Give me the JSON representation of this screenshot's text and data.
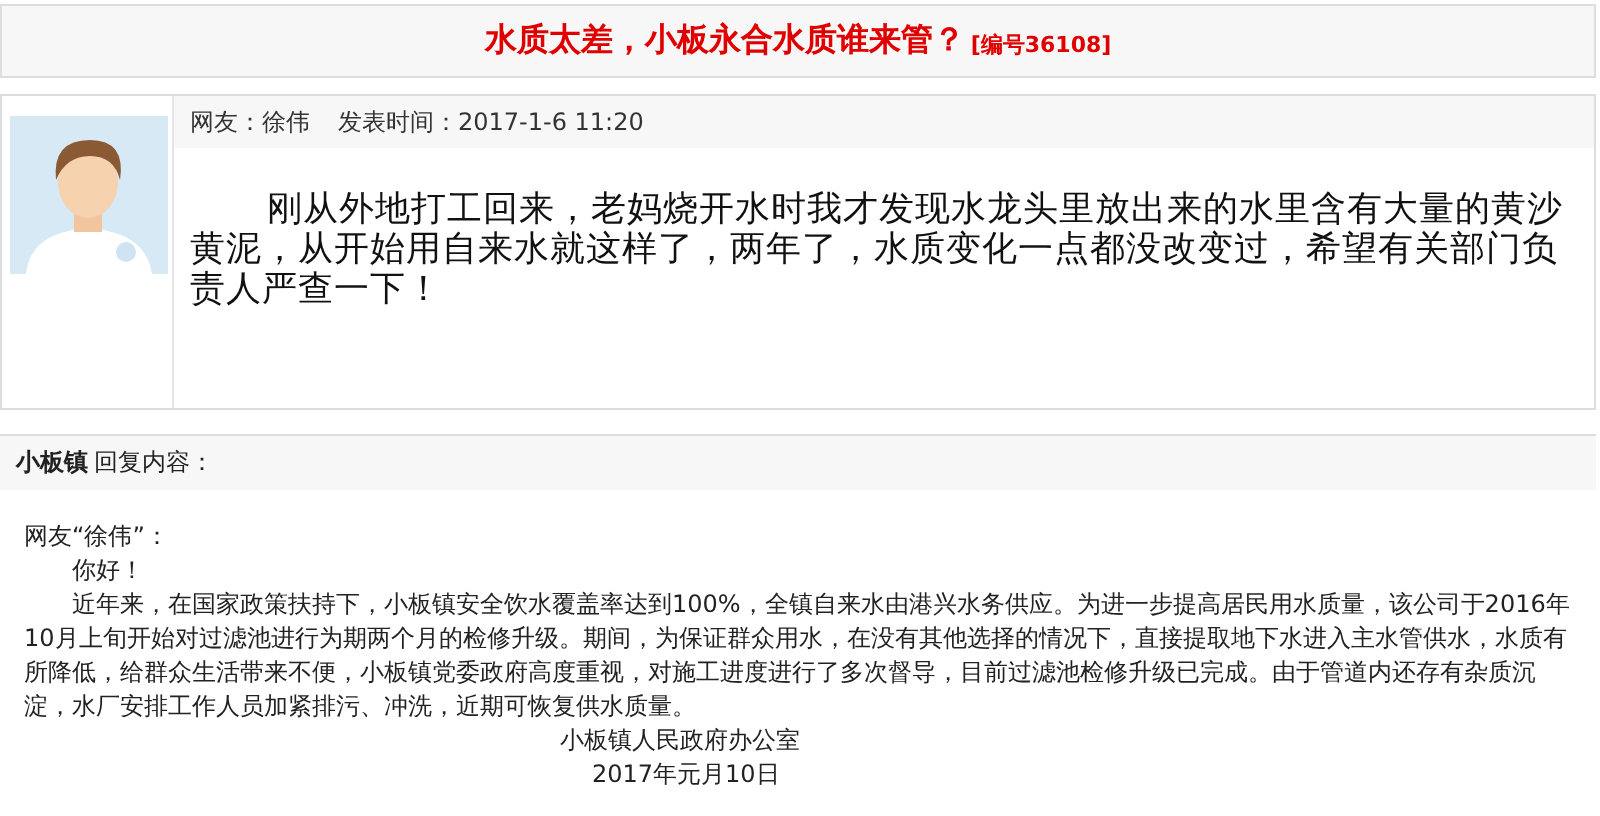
{
  "topic": {
    "title": "水质太差，小板永合水质谁来管？",
    "number": "[编号36108]"
  },
  "post": {
    "author_label": "网友：徐伟",
    "time_label": "发表时间：2017-1-6 11:20",
    "body": "刚从外地打工回来，老妈烧开水时我才发现水龙头里放出来的水里含有大量的黄沙黄泥，从开始用自来水就这样了，两年了，水质变化一点都没改变过，希望有关部门负责人严查一下！"
  },
  "reply": {
    "replier": "小板镇",
    "header_label": "回复内容：",
    "greeting_to": "网友“徐伟”：",
    "salutation": "你好！",
    "body": "近年来，在国家政策扶持下，小板镇安全饮水覆盖率达到100%，全镇自来水由港兴水务供应。为进一步提高居民用水质量，该公司于2016年10月上旬开始对过滤池进行为期两个月的检修升级。期间，为保证群众用水，在没有其他选择的情况下，直接提取地下水进入主水管供水，水质有所降低，给群众生活带来不便，小板镇党委政府高度重视，对施工进度进行了多次督导，目前过滤池检修升级已完成。由于管道内还存有杂质沉淀，水厂安排工作人员加紧排污、冲洗，近期可恢复供水质量。",
    "signature": "小板镇人民政府办公室",
    "date": "2017年元月10日"
  }
}
